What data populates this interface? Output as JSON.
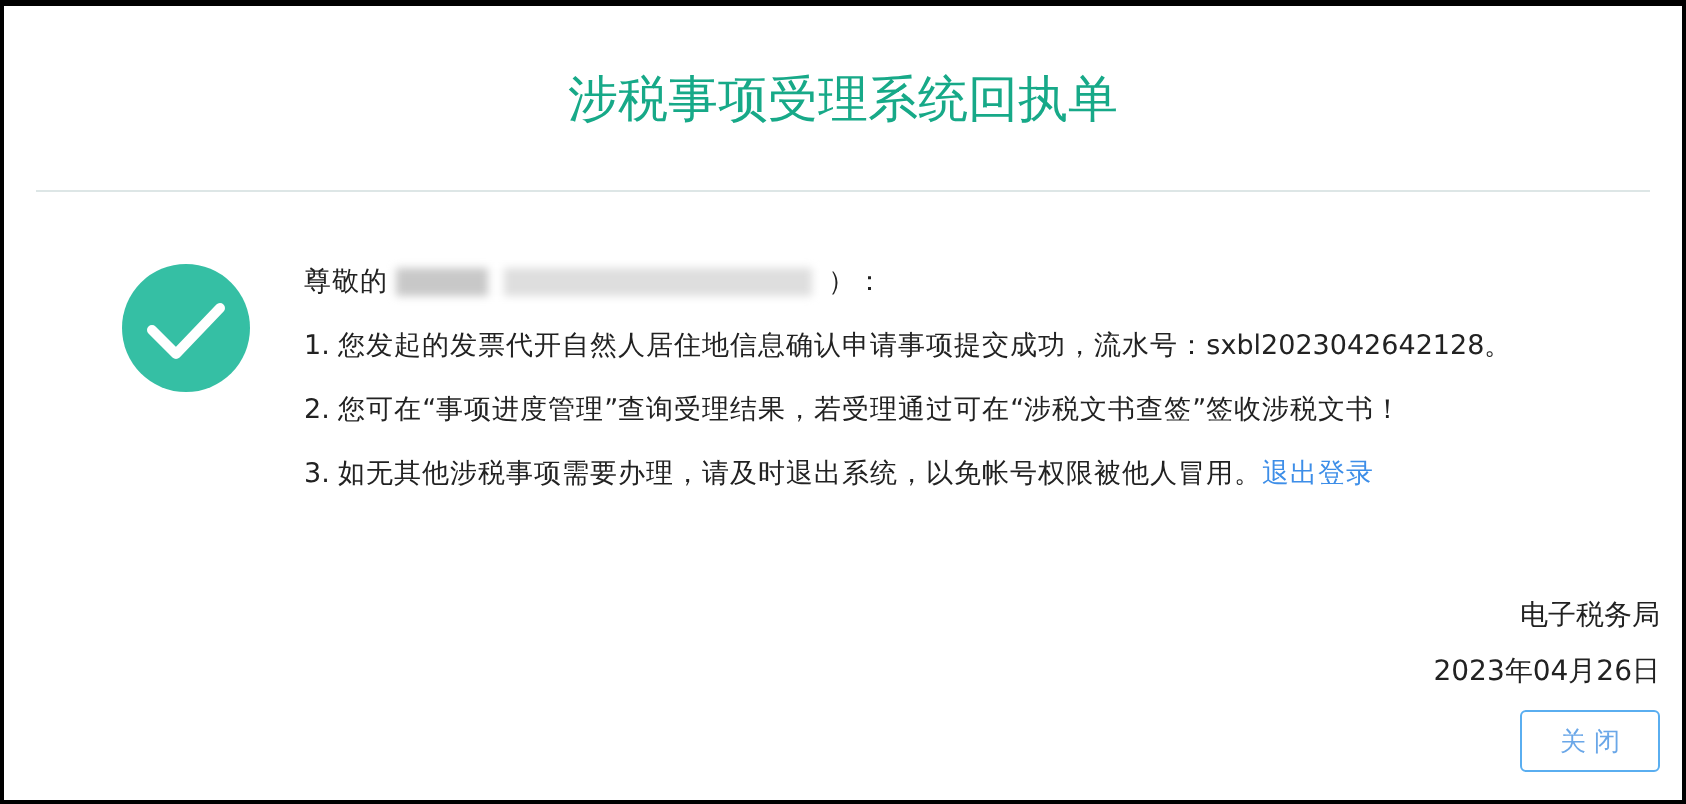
{
  "title": "涉税事项受理系统回执单",
  "greeting": {
    "prefix": "尊敬的",
    "suffix": "）："
  },
  "lines": [
    {
      "text": "1. 您发起的发票代开自然人居住地信息确认申请事项提交成功，流水号：sxbl2023042642128。"
    },
    {
      "text": "2. 您可在“事项进度管理”查询受理结果，若受理通过可在“涉税文书查签”签收涉税文书！"
    },
    {
      "text": "3. 如无其他涉税事项需要办理，请及时退出系统，以免帐号权限被他人冒用。",
      "link": "退出登录"
    }
  ],
  "issuer": "电子税务局",
  "date": "2023年04月26日",
  "close_button": "关 闭"
}
